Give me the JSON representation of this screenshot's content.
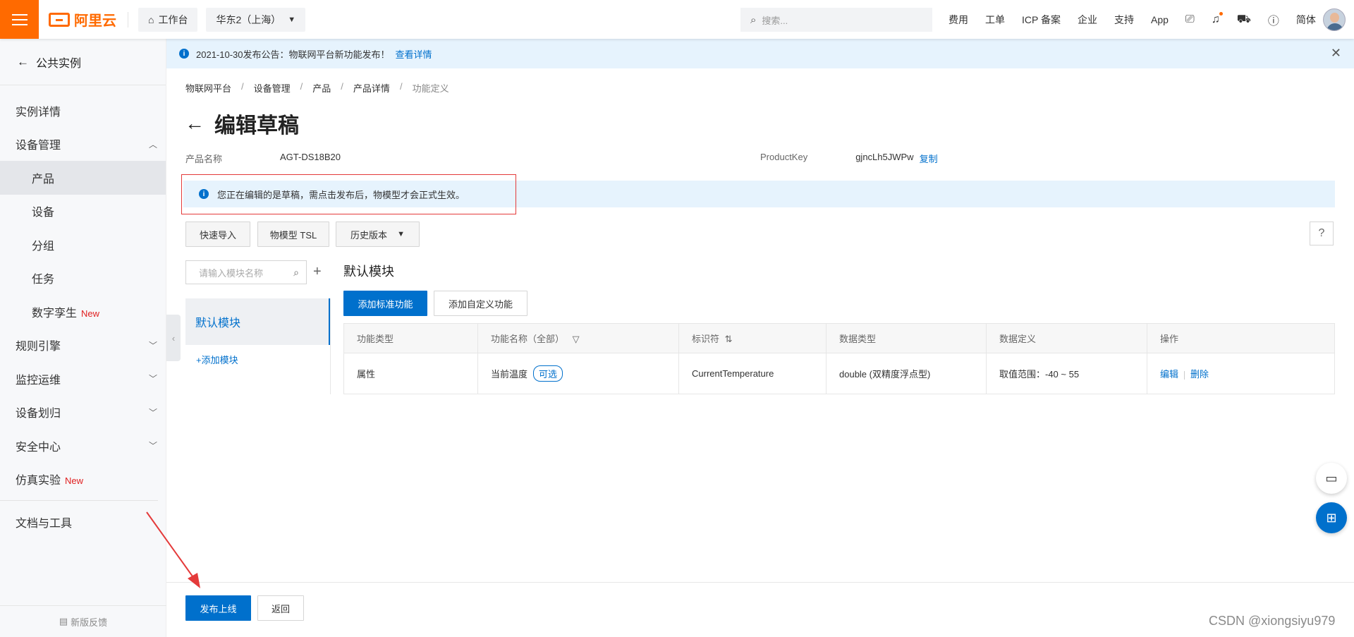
{
  "topbar": {
    "brand": "阿里云",
    "workbench": "工作台",
    "region": "华东2（上海）",
    "search_placeholder": "搜索...",
    "links": [
      "费用",
      "工单",
      "ICP 备案",
      "企业",
      "支持",
      "App"
    ],
    "lang": "简体"
  },
  "sidebar": {
    "back_label": "公共实例",
    "items": [
      {
        "label": "实例详情"
      },
      {
        "label": "设备管理"
      },
      {
        "label": "产品"
      },
      {
        "label": "设备"
      },
      {
        "label": "分组"
      },
      {
        "label": "任务"
      },
      {
        "label": "数字孪生",
        "badge": "New"
      },
      {
        "label": "规则引擎"
      },
      {
        "label": "监控运维"
      },
      {
        "label": "设备划归"
      },
      {
        "label": "安全中心"
      },
      {
        "label": "仿真实验",
        "badge": "New"
      },
      {
        "label": "文档与工具"
      }
    ],
    "feedback": "新版反馈"
  },
  "notice": {
    "text": "2021-10-30发布公告：物联网平台新功能发布！",
    "link": "查看详情"
  },
  "breadcrumb": [
    "物联网平台",
    "设备管理",
    "产品",
    "产品详情",
    "功能定义"
  ],
  "page": {
    "title": "编辑草稿",
    "product_name_label": "产品名称",
    "product_name": "AGT-DS18B20",
    "product_key_label": "ProductKey",
    "product_key": "gjncLh5JWPw",
    "copy": "复制",
    "draft_tip": "您正在编辑的是草稿，需点击发布后，物模型才会正式生效。"
  },
  "toolbar": {
    "quick_import": "快速导入",
    "tsl": "物模型 TSL",
    "history": "历史版本"
  },
  "modules": {
    "search_placeholder": "请输入模块名称",
    "items": [
      "默认模块"
    ],
    "add": "+添加模块"
  },
  "module_panel": {
    "title": "默认模块",
    "add_standard": "添加标准功能",
    "add_custom": "添加自定义功能",
    "columns": [
      "功能类型",
      "功能名称（全部）",
      "标识符",
      "数据类型",
      "数据定义",
      "操作"
    ],
    "rows": [
      {
        "type": "属性",
        "name": "当前温度",
        "tag": "可选",
        "identifier": "CurrentTemperature",
        "datatype": "double (双精度浮点型)",
        "definition": "取值范围：-40 ~ 55",
        "edit": "编辑",
        "delete": "删除"
      }
    ]
  },
  "footer": {
    "publish": "发布上线",
    "back": "返回"
  },
  "watermark": "CSDN @xiongsiyu979",
  "colors": {
    "accent": "#0070cc",
    "brand": "#ff6a00",
    "annotation": "#e43a3a"
  }
}
